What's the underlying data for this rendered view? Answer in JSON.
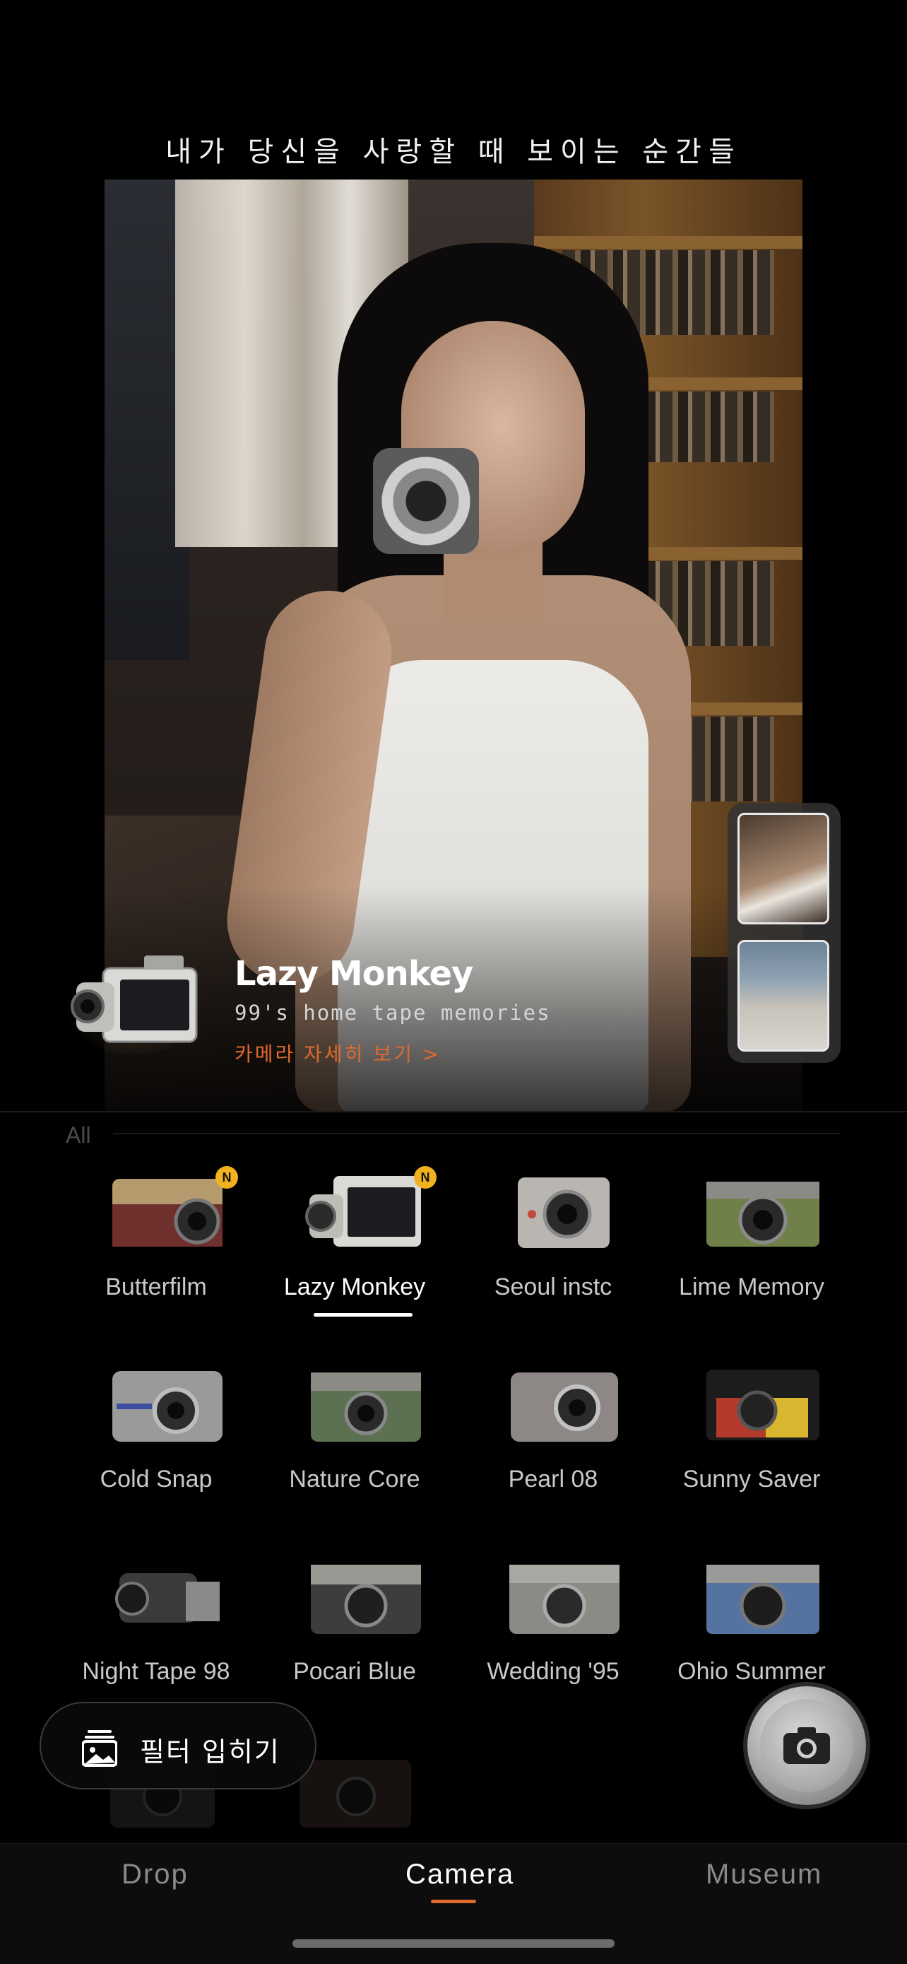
{
  "header": {
    "tagline": "내가 당신을 사랑할 때 보이는 순간들"
  },
  "hero": {
    "camera_name": "Lazy Monkey",
    "subtitle": "99's home tape memories",
    "details_link": "카메라 자세히 보기 >"
  },
  "section": {
    "label": "All"
  },
  "cameras": [
    {
      "name": "Butterfilm",
      "badge": "N"
    },
    {
      "name": "Lazy Monkey",
      "badge": "N",
      "selected": true
    },
    {
      "name": "Seoul instc"
    },
    {
      "name": "Lime Memory"
    },
    {
      "name": "Cold Snap"
    },
    {
      "name": "Nature Core"
    },
    {
      "name": "Pearl 08"
    },
    {
      "name": "Sunny Saver"
    },
    {
      "name": "Night Tape 98"
    },
    {
      "name": "Pocari Blue"
    },
    {
      "name": "Wedding '95"
    },
    {
      "name": "Ohio Summer"
    }
  ],
  "filter_button": {
    "label": "필터 입히기",
    "icon": "image-layers-icon"
  },
  "shutter": {
    "icon": "camera-icon"
  },
  "tabs": [
    {
      "label": "Drop"
    },
    {
      "label": "Camera",
      "active": true
    },
    {
      "label": "Museum"
    }
  ],
  "colors": {
    "accent": "#e06a2e",
    "badge": "#f0b21f",
    "background": "#000000"
  }
}
